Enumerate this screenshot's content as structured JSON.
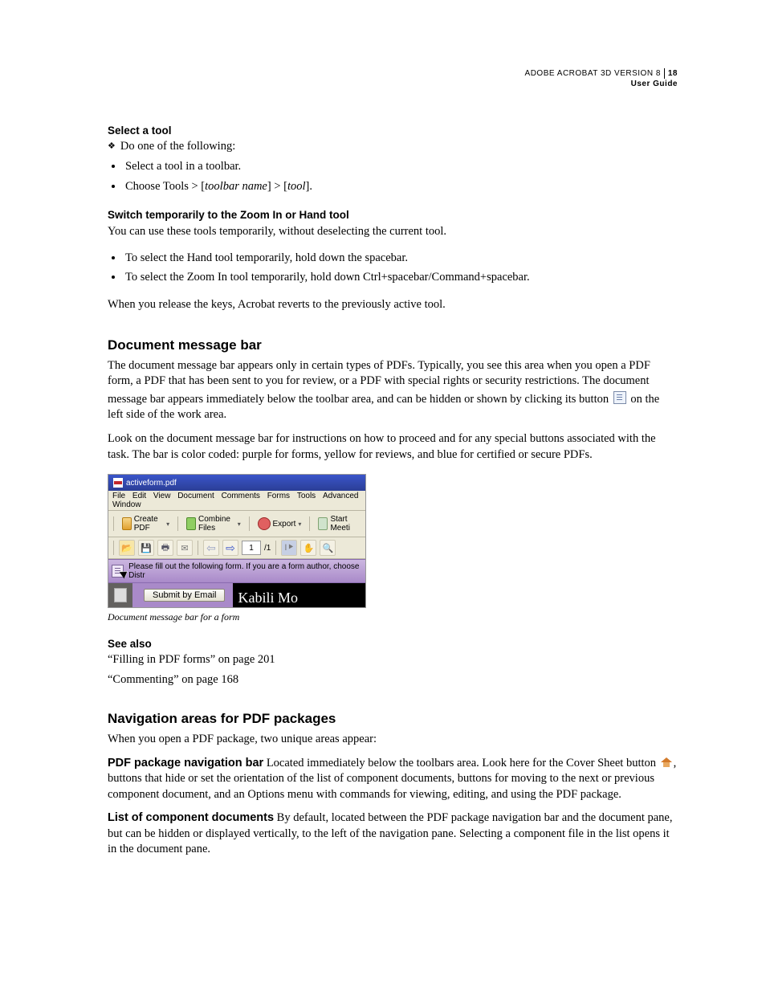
{
  "header": {
    "line1": "ADOBE ACROBAT 3D VERSION 8",
    "pagenum": "18",
    "line2": "User Guide"
  },
  "sec1": {
    "h": "Select a tool",
    "lead": "Do one of the following:",
    "b1": "Select a tool in a toolbar.",
    "b2_a": "Choose Tools > [",
    "b2_i1": "toolbar name",
    "b2_b": "] > [",
    "b2_i2": "tool",
    "b2_c": "]."
  },
  "sec2": {
    "h": "Switch temporarily to the Zoom In or Hand tool",
    "p": "You can use these tools temporarily, without deselecting the current tool.",
    "b1": "To select the Hand tool temporarily, hold down the spacebar.",
    "b2": "To select the Zoom In tool temporarily, hold down Ctrl+spacebar/Command+spacebar.",
    "p2": "When you release the keys, Acrobat reverts to the previously active tool."
  },
  "dmb": {
    "h": "Document message bar",
    "p1a": "The document message bar appears only in certain types of PDFs. Typically, you see this area when you open a PDF form, a PDF that has been sent to you for review, or a PDF with special rights or security restrictions. The document message bar appears immediately below the toolbar area, and can be hidden or shown by clicking its button ",
    "p1b": " on the left side of the work area.",
    "p2": "Look on the document message bar for instructions on how to proceed and for any special buttons associated with the task. The bar is color coded: purple for forms, yellow for reviews, and blue for certified or secure PDFs."
  },
  "shot": {
    "title": "activeform.pdf",
    "menu": {
      "m1": "File",
      "m2": "Edit",
      "m3": "View",
      "m4": "Document",
      "m5": "Comments",
      "m6": "Forms",
      "m7": "Tools",
      "m8": "Advanced",
      "m9": "Window"
    },
    "tb": {
      "create": "Create PDF",
      "combine": "Combine Files",
      "export": "Export",
      "meet": "Start Meeti"
    },
    "nav": {
      "page": "1",
      "total": "/1"
    },
    "msg": "Please fill out the following form. If you are a form author, choose Distr",
    "submit": "Submit by Email",
    "kabili": "Kabili Mo"
  },
  "caption": "Document message bar for a form",
  "seealso": {
    "h": "See also",
    "l1": "“Filling in PDF forms” on page 201",
    "l2": "“Commenting” on page 168"
  },
  "navpkg": {
    "h": "Navigation areas for PDF packages",
    "p1": "When you open a PDF package, two unique areas appear:",
    "t1": "PDF package navigation bar",
    "p2a": "  Located immediately below the toolbars area. Look here for the Cover Sheet button ",
    "p2b": ", buttons that hide or set the orientation of the list of component documents, buttons for moving to the next or previous component document, and an Options menu with commands for viewing, editing, and using the PDF package.",
    "t2": "List of component documents",
    "p3": "  By default, located between the PDF package navigation bar and the document pane, but can be hidden or displayed vertically, to the left of the navigation pane. Selecting a component file in the list opens it in the document pane."
  }
}
